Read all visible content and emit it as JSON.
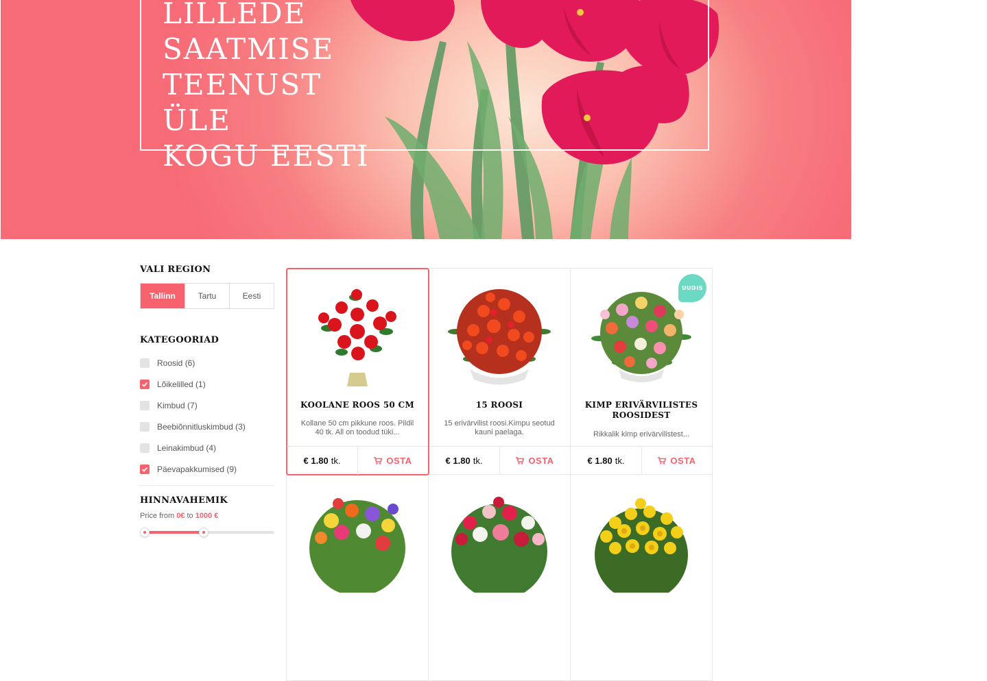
{
  "hero": {
    "title_lines": [
      "LILLEDE",
      "SAATMISE",
      "TEENUST ÜLE",
      "KOGU EESTI"
    ]
  },
  "sidebar": {
    "region_heading": "VALI REGION",
    "regions": [
      {
        "label": "Tallinn",
        "active": true
      },
      {
        "label": "Tartu",
        "active": false
      },
      {
        "label": "Eesti",
        "active": false
      }
    ],
    "categories_heading": "KATEGOORIAD",
    "categories": [
      {
        "label": "Roosid (6)",
        "checked": false
      },
      {
        "label": "Lõikelilled (1)",
        "checked": true
      },
      {
        "label": "Kimbud (7)",
        "checked": false
      },
      {
        "label": "Beebiõnnitluskimbud (3)",
        "checked": false
      },
      {
        "label": "Leinakimbud (4)",
        "checked": false
      },
      {
        "label": "Päevapakkumised (9)",
        "checked": true
      }
    ],
    "price_heading": "HINNAVAHEMIK",
    "price_prefix": "Price from",
    "price_min": "0€",
    "price_to": "to",
    "price_max": "1000 €",
    "slider_fraction": 0.44
  },
  "products": [
    {
      "title": "KOOLANE ROOS 50 CM",
      "desc": "Kollane 50 cm pikkune roos. Pildil 40 tk. All on toodud tüki...",
      "price": "€ 1.80",
      "unit": "tk.",
      "buy": "OSTA",
      "badge": ""
    },
    {
      "title": "15 ROOSI",
      "desc": "15 erivärvilist roosi.Kimpu seotud kauni paelaga.",
      "price": "€ 1.80",
      "unit": "tk.",
      "buy": "OSTA",
      "badge": ""
    },
    {
      "title": "KIMP ERIVÄRVILISTES ROOSIDEST",
      "desc": "Rikkalik kimp erivärvilistest...",
      "price": "€ 1.80",
      "unit": "tk.",
      "buy": "OSTA",
      "badge": "UUDIS"
    }
  ],
  "colors": {
    "accent": "#f7626d",
    "badge": "#6cd9c3"
  }
}
